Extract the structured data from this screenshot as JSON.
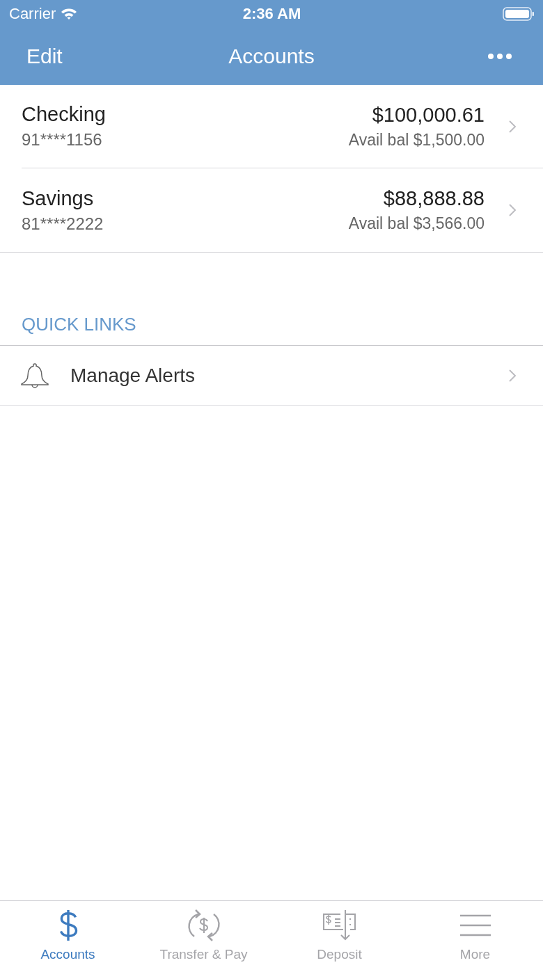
{
  "status_bar": {
    "carrier": "Carrier",
    "time": "2:36 AM"
  },
  "nav_bar": {
    "left_button": "Edit",
    "title": "Accounts"
  },
  "accounts": [
    {
      "name": "Checking",
      "number": "91****1156",
      "balance": "$100,000.61",
      "available": "Avail bal $1,500.00"
    },
    {
      "name": "Savings",
      "number": "81****2222",
      "balance": "$88,888.88",
      "available": "Avail bal $3,566.00"
    }
  ],
  "quick_links": {
    "heading": "QUICK LINKS",
    "items": [
      {
        "label": "Manage Alerts"
      }
    ]
  },
  "tab_bar": [
    {
      "label": "Accounts",
      "selected": true
    },
    {
      "label": "Transfer & Pay",
      "selected": false
    },
    {
      "label": "Deposit",
      "selected": false
    },
    {
      "label": "More",
      "selected": false
    }
  ]
}
